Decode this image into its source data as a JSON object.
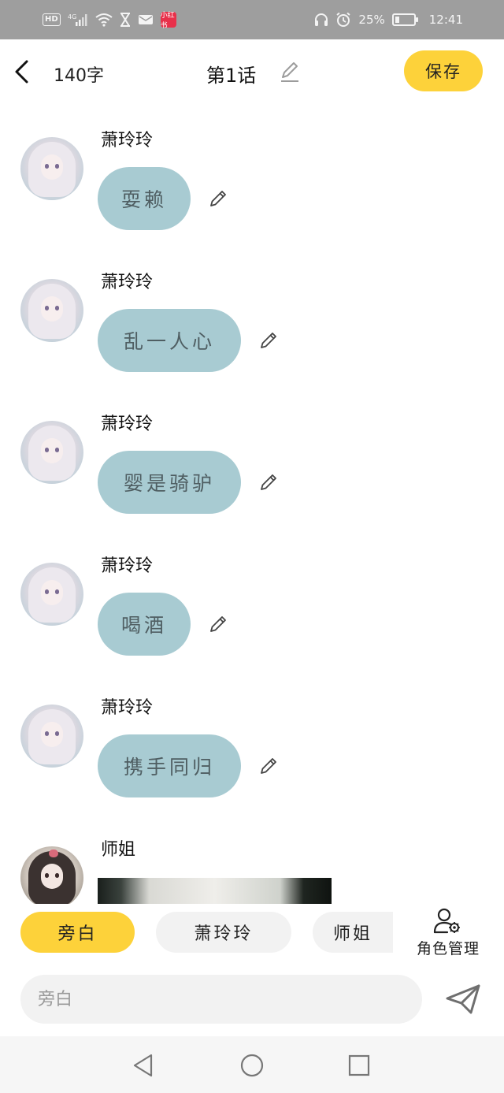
{
  "status_bar": {
    "hd": "HD",
    "network": "4G",
    "app_badge": "小红书",
    "battery_percent": "25%",
    "battery_level": 0.25,
    "time": "12:41",
    "icons": [
      "hd-icon",
      "signal-icon",
      "wifi-icon",
      "hourglass-icon",
      "mail-icon",
      "xiaohongshu-app-icon",
      "headphones-icon",
      "alarm-icon",
      "battery-icon"
    ]
  },
  "header": {
    "word_count": "140字",
    "title": "第1话",
    "save_label": "保存",
    "back_icon": "chevron-left-icon",
    "edit_icon": "pencil-icon"
  },
  "messages": [
    {
      "speaker": "萧玲玲",
      "text": "耍赖",
      "type": "text"
    },
    {
      "speaker": "萧玲玲",
      "text": "乱一人心",
      "type": "text"
    },
    {
      "speaker": "萧玲玲",
      "text": "婴是骑驴",
      "type": "text"
    },
    {
      "speaker": "萧玲玲",
      "text": "喝酒",
      "type": "text"
    },
    {
      "speaker": "萧玲玲",
      "text": "携手同归",
      "type": "text"
    },
    {
      "speaker": "师姐",
      "type": "image"
    }
  ],
  "characters": [
    {
      "name": "旁白",
      "active": true
    },
    {
      "name": "萧玲玲",
      "active": false
    },
    {
      "name": "师姐",
      "active": false
    }
  ],
  "role_management": {
    "label": "角色管理",
    "icon": "user-gear-icon"
  },
  "input": {
    "placeholder": "旁白",
    "value": ""
  },
  "send_icon": "paper-plane-icon",
  "nav": {
    "icons": [
      "back-triangle-icon",
      "home-circle-icon",
      "recents-square-icon"
    ]
  },
  "colors": {
    "accent_yellow": "#fdd23a",
    "bubble": "#a8cbd2",
    "bubble_text": "#4f5e62",
    "status_bar_bg": "#9e9e9e",
    "chip_bg": "#f2f2f2"
  }
}
